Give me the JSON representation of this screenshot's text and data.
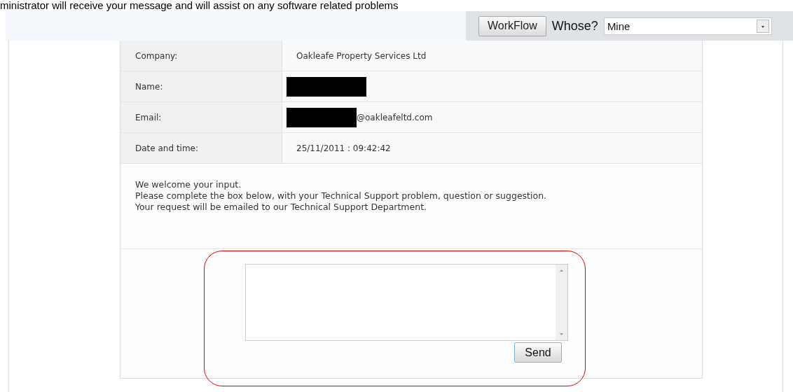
{
  "caption": "ministrator will receive your message and will assist on any software related problems",
  "toolbar": {
    "workflow_button": "WorkFlow",
    "whose_label": "Whose?",
    "whose_select": {
      "value": "Mine"
    }
  },
  "details": [
    {
      "label": "Company:",
      "value": "Oakleafe Property Services Ltd",
      "redacted": false
    },
    {
      "label": "Name:",
      "redacted": true
    },
    {
      "label": "Email:",
      "value": "@oakleafeltd.com",
      "redacted": true
    },
    {
      "label": "Date and time:",
      "value": "25/11/2011 : 09:42:42",
      "redacted": false
    }
  ],
  "intro": [
    "We welcome your input.",
    "Please complete the box below, with your Technical Support problem, question or suggestion.",
    "Your request will be emailed to our Technical Support Department."
  ],
  "send_button": "Send"
}
